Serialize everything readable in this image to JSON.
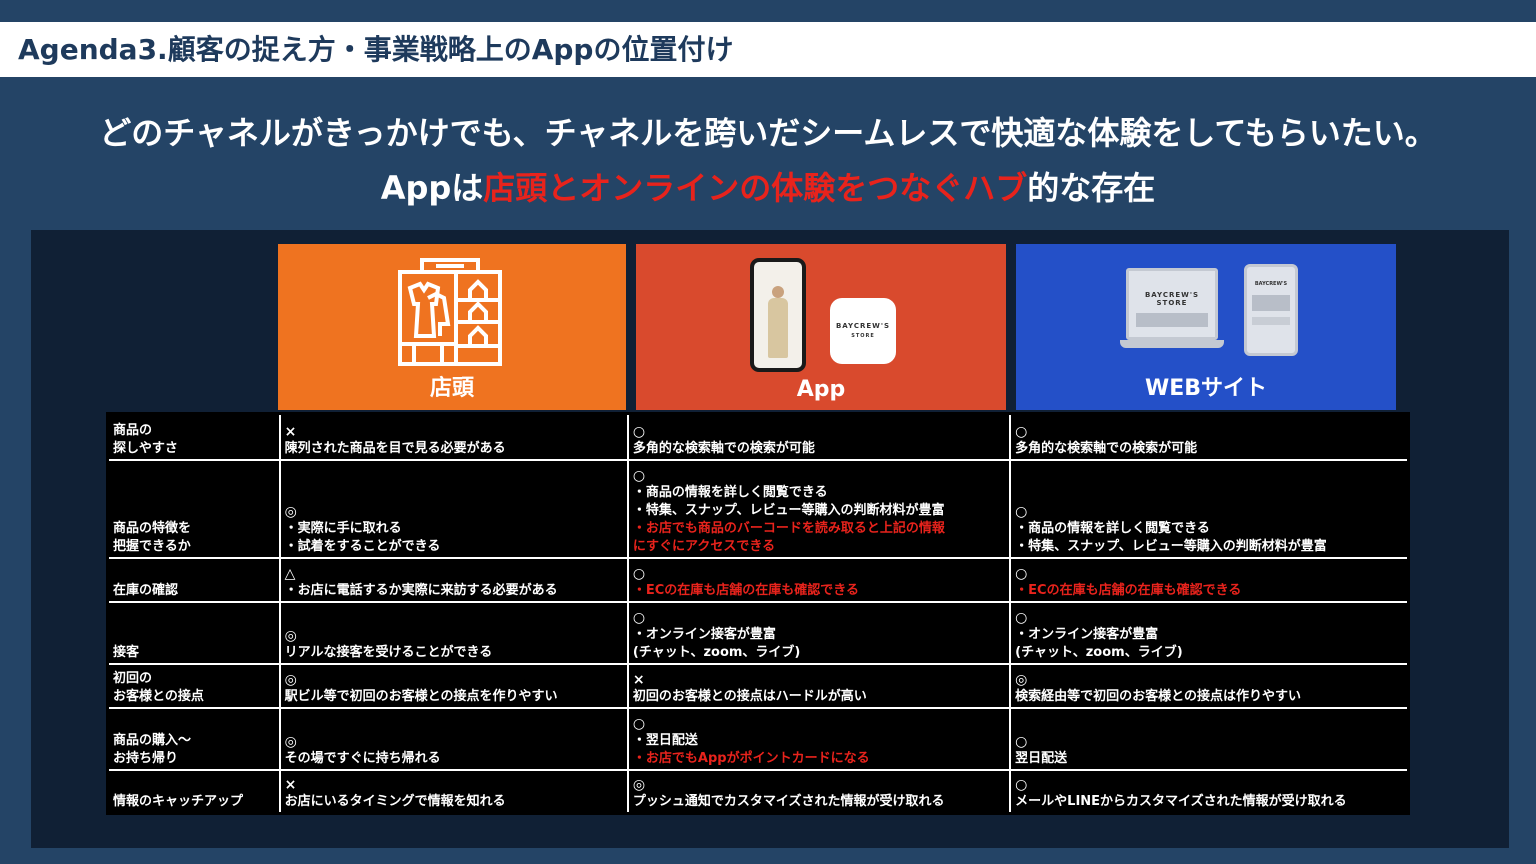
{
  "title": "Agenda3.顧客の捉え方・事業戦略上のAppの位置付け",
  "headline": "どのチャネルがきっかけでも、チャネルを跨いだシームレスで快適な体験をしてもらいたい。",
  "subline": {
    "prefix": "Appは",
    "highlight": "店頭とオンラインの体験をつなぐハブ",
    "suffix": "的な存在"
  },
  "channels": {
    "store": {
      "label": "店頭",
      "color": "#ef7320"
    },
    "app": {
      "label": "App",
      "color": "#d94a2d",
      "logo_line1": "BAYCREW'S",
      "logo_line2": "STORE"
    },
    "web": {
      "label": "WEBサイト",
      "color": "#2450c8",
      "screen_text": "BAYCREW'S STORE",
      "phone_text": "BAYCREW'S"
    }
  },
  "rows": [
    {
      "header": [
        "商品の",
        "探しやすさ"
      ],
      "store": {
        "mark": "×",
        "lines": [
          {
            "t": "陳列された商品を目で見る必要がある",
            "red": false
          }
        ]
      },
      "app": {
        "mark": "○",
        "lines": [
          {
            "t": "多角的な検索軸での検索が可能",
            "red": false
          }
        ]
      },
      "web": {
        "mark": "○",
        "lines": [
          {
            "t": "多角的な検索軸での検索が可能",
            "red": false
          }
        ]
      }
    },
    {
      "header": [
        "商品の特徴を",
        "把握できるか"
      ],
      "store": {
        "mark": "◎",
        "lines": [
          {
            "t": "・実際に手に取れる",
            "red": false
          },
          {
            "t": "・試着をすることができる",
            "red": false
          }
        ]
      },
      "app": {
        "mark": "○",
        "lines": [
          {
            "t": "・商品の情報を詳しく閲覧できる",
            "red": false
          },
          {
            "t": "・特集、スナップ、レビュー等購入の判断材料が豊富",
            "red": false
          },
          {
            "t": "・お店でも商品のバーコードを読み取ると上記の情報",
            "red": true
          },
          {
            "t": "にすぐにアクセスできる",
            "red": true
          }
        ]
      },
      "web": {
        "mark": "○",
        "lines": [
          {
            "t": "・商品の情報を詳しく閲覧できる",
            "red": false
          },
          {
            "t": "・特集、スナップ、レビュー等購入の判断材料が豊富",
            "red": false
          }
        ]
      }
    },
    {
      "header": [
        "在庫の確認"
      ],
      "store": {
        "mark": "△",
        "lines": [
          {
            "t": "・お店に電話するか実際に来訪する必要がある",
            "red": false
          }
        ]
      },
      "app": {
        "mark": "○",
        "lines": [
          {
            "t": "・ECの在庫も店舗の在庫も確認できる",
            "red": true
          }
        ]
      },
      "web": {
        "mark": "○",
        "lines": [
          {
            "t": "・ECの在庫も店舗の在庫も確認できる",
            "red": true
          }
        ]
      }
    },
    {
      "header": [
        "接客"
      ],
      "store": {
        "mark": "◎",
        "lines": [
          {
            "t": "リアルな接客を受けることができる",
            "red": false
          }
        ]
      },
      "app": {
        "mark": "○",
        "lines": [
          {
            "t": "・オンライン接客が豊富",
            "red": false
          },
          {
            "t": "(チャット、zoom、ライブ)",
            "red": false
          }
        ]
      },
      "web": {
        "mark": "○",
        "lines": [
          {
            "t": "・オンライン接客が豊富",
            "red": false
          },
          {
            "t": "(チャット、zoom、ライブ)",
            "red": false
          }
        ]
      }
    },
    {
      "header": [
        "初回の",
        "お客様との接点"
      ],
      "store": {
        "mark": "◎",
        "lines": [
          {
            "t": "駅ビル等で初回のお客様との接点を作りやすい",
            "red": false
          }
        ]
      },
      "app": {
        "mark": "×",
        "lines": [
          {
            "t": "初回のお客様との接点はハードルが高い",
            "red": false
          }
        ]
      },
      "web": {
        "mark": "◎",
        "lines": [
          {
            "t": "検索経由等で初回のお客様との接点は作りやすい",
            "red": false
          }
        ]
      }
    },
    {
      "header": [
        "商品の購入〜",
        "お持ち帰り"
      ],
      "store": {
        "mark": "◎",
        "lines": [
          {
            "t": "その場ですぐに持ち帰れる",
            "red": false
          }
        ]
      },
      "app": {
        "mark": "○",
        "lines": [
          {
            "t": "・翌日配送",
            "red": false
          },
          {
            "t": "・お店でもAppがポイントカードになる",
            "red": true
          }
        ]
      },
      "web": {
        "mark": "○",
        "lines": [
          {
            "t": "翌日配送",
            "red": false
          }
        ]
      }
    },
    {
      "header": [
        "情報のキャッチアップ"
      ],
      "store": {
        "mark": "×",
        "lines": [
          {
            "t": "お店にいるタイミングで情報を知れる",
            "red": false
          }
        ]
      },
      "app": {
        "mark": "◎",
        "lines": [
          {
            "t": "プッシュ通知でカスタマイズされた情報が受け取れる",
            "red": false
          }
        ]
      },
      "web": {
        "mark": "○",
        "lines": [
          {
            "t": "メールやLINEからカスタマイズされた情報が受け取れる",
            "red": false
          }
        ]
      }
    }
  ]
}
